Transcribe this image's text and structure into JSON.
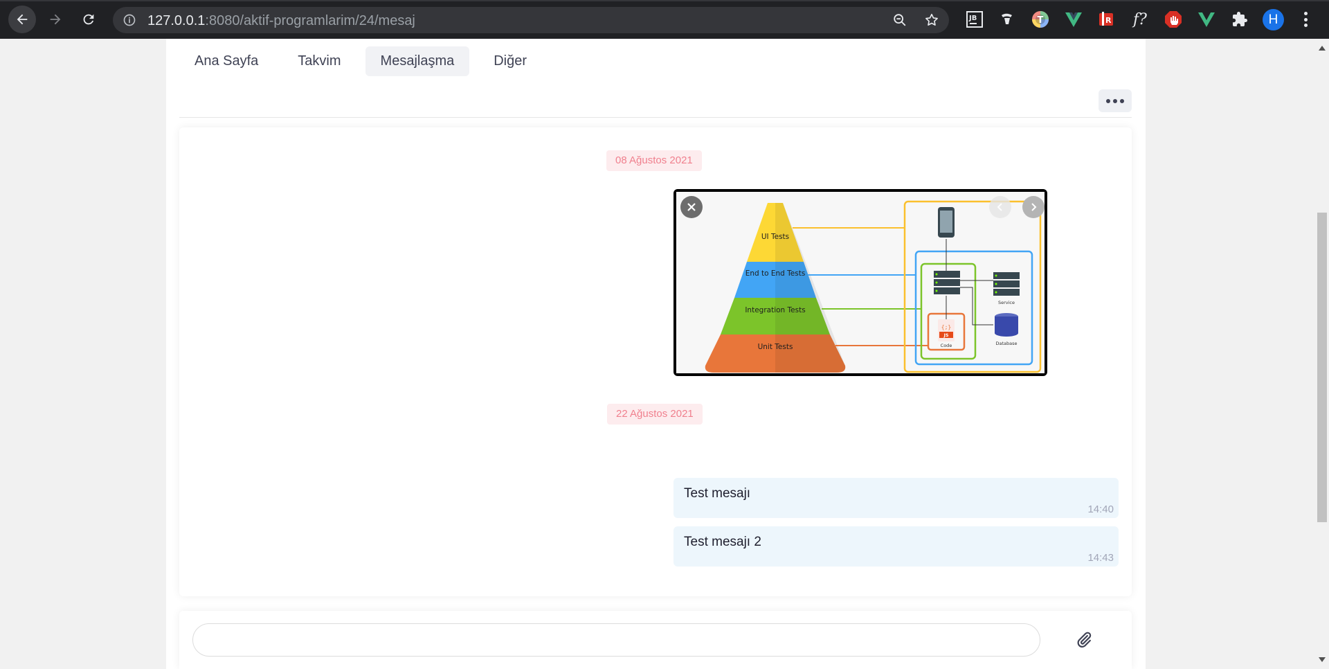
{
  "browser": {
    "url_host": "127.0.0.1",
    "url_rest": ":8080/aktif-programlarim/24/mesaj",
    "profile_initial": "H",
    "extensions": [
      "jetbrains-icon",
      "pen-icon",
      "t-icon",
      "vue-devtools-icon",
      "lr-icon",
      "font-finder-icon",
      "stop-icon",
      "vue-icon",
      "puzzle-icon"
    ],
    "jb_label": "JB",
    "font_label": "f?"
  },
  "nav": {
    "tabs": [
      {
        "label": "Ana Sayfa"
      },
      {
        "label": "Takvim"
      },
      {
        "label": "Mesajlaşma"
      },
      {
        "label": "Diğer"
      }
    ],
    "active_tab": "Mesajlaşma"
  },
  "chat": {
    "groups": [
      {
        "date": "08 Ağustos 2021"
      },
      {
        "date": "22 Ağustos 2021"
      }
    ],
    "image": {
      "pyramid_labels": [
        "UI Tests",
        "End to End Tests",
        "Integration Tests",
        "Unit Tests"
      ],
      "diagram_labels": {
        "service": "Service",
        "database": "Database",
        "code": "Code",
        "js": "JS",
        "braces": "{;}"
      }
    },
    "messages": [
      {
        "text": "Test mesajı",
        "time": "14:40"
      },
      {
        "text": "Test mesajı 2",
        "time": "14:43"
      }
    ]
  },
  "composer": {
    "value": "",
    "placeholder": ""
  },
  "colors": {
    "date_badge_bg": "#fdecee",
    "date_badge_text": "#f0808e",
    "message_bg": "#edf6fc"
  }
}
